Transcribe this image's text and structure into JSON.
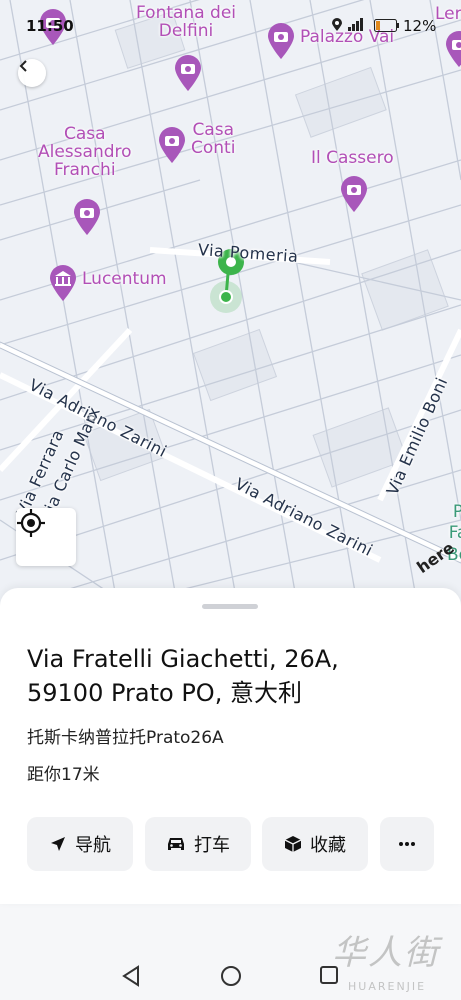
{
  "status_bar": {
    "time": "11:50",
    "battery": "12%"
  },
  "map": {
    "pois": [
      {
        "id": "fontana-dei-delfini",
        "label_lines": [
          "Fontana dei",
          "Delfini"
        ],
        "icon": "camera-icon"
      },
      {
        "id": "palazzo-vai",
        "label_lines": [
          "Palazzo Vai"
        ],
        "icon": "camera-icon"
      },
      {
        "id": "casa-conti",
        "label_lines": [
          "Casa",
          "Conti"
        ],
        "icon": "camera-icon"
      },
      {
        "id": "casa-alessandro-franchi",
        "label_lines": [
          "Casa",
          "Alessandro",
          "Franchi"
        ],
        "icon": "camera-icon"
      },
      {
        "id": "il-cassero",
        "label_lines": [
          "Il Cassero"
        ],
        "icon": "camera-icon"
      },
      {
        "id": "lucentum",
        "label_lines": [
          "Lucentum"
        ],
        "icon": "museum-icon"
      }
    ],
    "edge_labels": [
      "Ler",
      "P",
      "Fa",
      "Bo"
    ],
    "streets": {
      "via_pomeria": "Via Pomeria",
      "via_adriano_zarini_1": "Via Adriano Zarini",
      "via_adriano_zarini_2": "Via Adriano Zarini",
      "via_emilio_boni": "Via Emilio Boni",
      "via_ferrara": "Via Ferrara",
      "via_carlo_marx": "Via Carlo Marx"
    },
    "attribution": "here",
    "poi_color": "#b24fb6",
    "pin_color": "#3cb44b"
  },
  "sheet": {
    "address_line1": "Via Fratelli Giachetti, 26A,",
    "address_line2": "59100 Prato PO, 意大利",
    "region": "托斯卡纳普拉托Prato26A",
    "distance": "距你17米",
    "actions": [
      {
        "label": "导航",
        "icon": "navigation-arrow-icon"
      },
      {
        "label": "打车",
        "icon": "car-icon"
      },
      {
        "label": "收藏",
        "icon": "box-icon"
      },
      {
        "label": "",
        "icon": "more-icon"
      }
    ]
  },
  "watermark": {
    "cn": "华人街",
    "en": "HUARENJIE"
  }
}
